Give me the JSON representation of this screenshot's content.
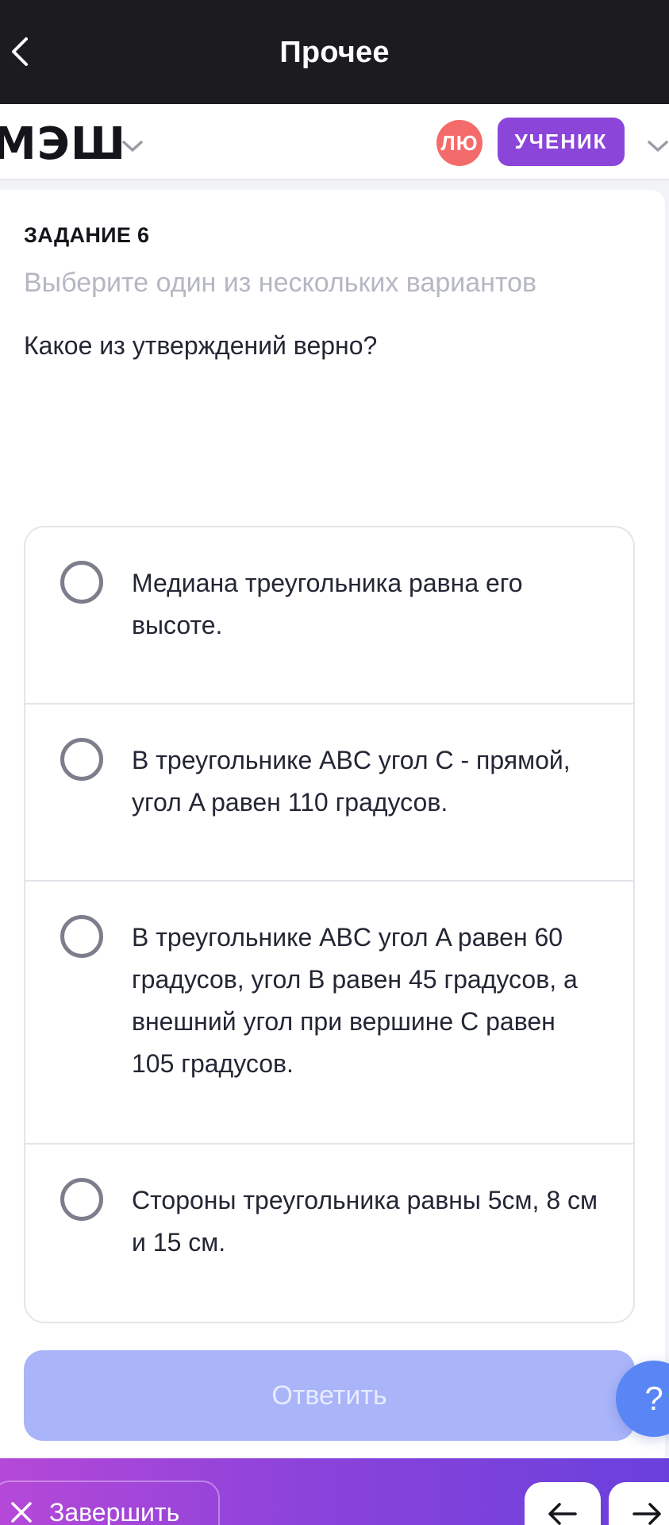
{
  "topbar": {
    "title": "Прочее"
  },
  "header": {
    "logo": "МЭШ",
    "avatar_initials": "ЛЮ",
    "role": "УЧЕНИК"
  },
  "task": {
    "label": "ЗАДАНИЕ 6",
    "hint": "Выберите один из нескольких вариантов",
    "question": "Какое из утверждений верно?",
    "options": [
      {
        "text": "Медиана треугольника равна его высоте."
      },
      {
        "text": "В треугольнике ABC угол C - прямой, угол A равен 110 градусов."
      },
      {
        "text": "В треугольнике ABC угол A равен 60 градусов, угол B равен 45 градусов, а внешний угол при вершине C равен 105 градусов."
      },
      {
        "text": "Стороны треугольника равны 5см, 8 см и 15 см."
      }
    ],
    "answer_label": "Ответить"
  },
  "help": {
    "label": "?"
  },
  "bottombar": {
    "finish_label": "Завершить"
  },
  "colors": {
    "accent": "#8b45d9",
    "answer_button": "#a9b4f9",
    "avatar": "#f46b6b",
    "help": "#5a86f5"
  },
  "icons": {
    "back": "chevron-left-icon",
    "dropdown": "chevron-down-icon",
    "close": "close-icon",
    "prev": "arrow-left-icon",
    "next": "arrow-right-icon"
  }
}
